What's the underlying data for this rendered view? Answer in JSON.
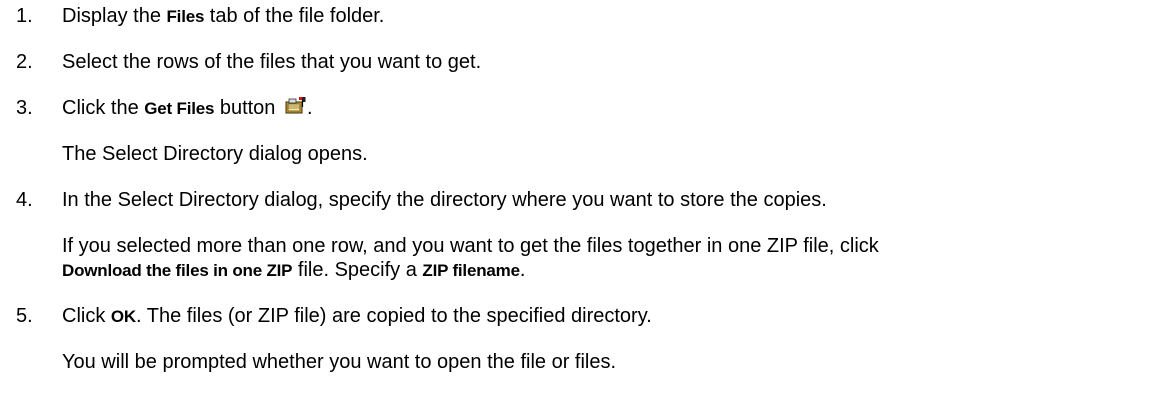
{
  "steps": [
    {
      "number": "1.",
      "pre": "Display the ",
      "bold": "Files",
      "post": " tab of the file folder."
    },
    {
      "number": "2.",
      "text": "Select the rows of the files that you want to get."
    },
    {
      "number": "3.",
      "pre": "Click the ",
      "bold": "Get Files",
      "post": " button ",
      "icon": "get-files-icon",
      "end": ".",
      "note": "The Select Directory dialog opens."
    },
    {
      "number": "4.",
      "text": "In the Select Directory dialog, specify the directory where you want to store the copies.",
      "note_line1": "If you selected more than one row, and you want to get the files together in one ZIP file, click",
      "note_bold1": "Download the files in one ZIP",
      "note_mid": " file. Specify a ",
      "note_bold2": "ZIP filename",
      "note_end": "."
    },
    {
      "number": "5.",
      "pre": "Click ",
      "bold": "OK",
      "post": ". The files (or ZIP file) are copied to the specified directory.",
      "note": "You will be prompted whether you want to open the file or files."
    }
  ]
}
